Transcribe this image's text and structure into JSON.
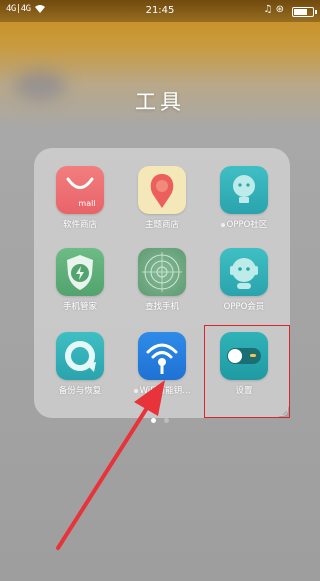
{
  "status_bar": {
    "signal_text": "4G|4G",
    "time": "21:45",
    "right_icons": "♫ ⊛",
    "battery_level": 0.7
  },
  "folder": {
    "title": "工具",
    "apps": [
      {
        "label": "软件商店",
        "icon": "mall-bag-icon",
        "icon_text": "mall",
        "new_dot": false
      },
      {
        "label": "主题商店",
        "icon": "theme-balloon-icon",
        "new_dot": false
      },
      {
        "label": "OPPO社区",
        "icon": "community-bulb-icon",
        "new_dot": true
      },
      {
        "label": "手机管家",
        "icon": "shield-lightning-icon",
        "new_dot": false
      },
      {
        "label": "查找手机",
        "icon": "radar-icon",
        "new_dot": false
      },
      {
        "label": "OPPO会员",
        "icon": "member-robot-icon",
        "new_dot": false
      },
      {
        "label": "备份与恢复",
        "icon": "backup-restore-icon",
        "new_dot": false
      },
      {
        "label": "WiFi万能钥...",
        "icon": "wifi-key-icon",
        "new_dot": true
      },
      {
        "label": "设置",
        "icon": "settings-toggle-icon",
        "new_dot": false
      }
    ],
    "page_count": 2,
    "current_page": 1
  },
  "annotations": {
    "highlight_target": "设置",
    "colors": {
      "highlight": "#d9262a",
      "arrow": "#e8333a"
    }
  }
}
